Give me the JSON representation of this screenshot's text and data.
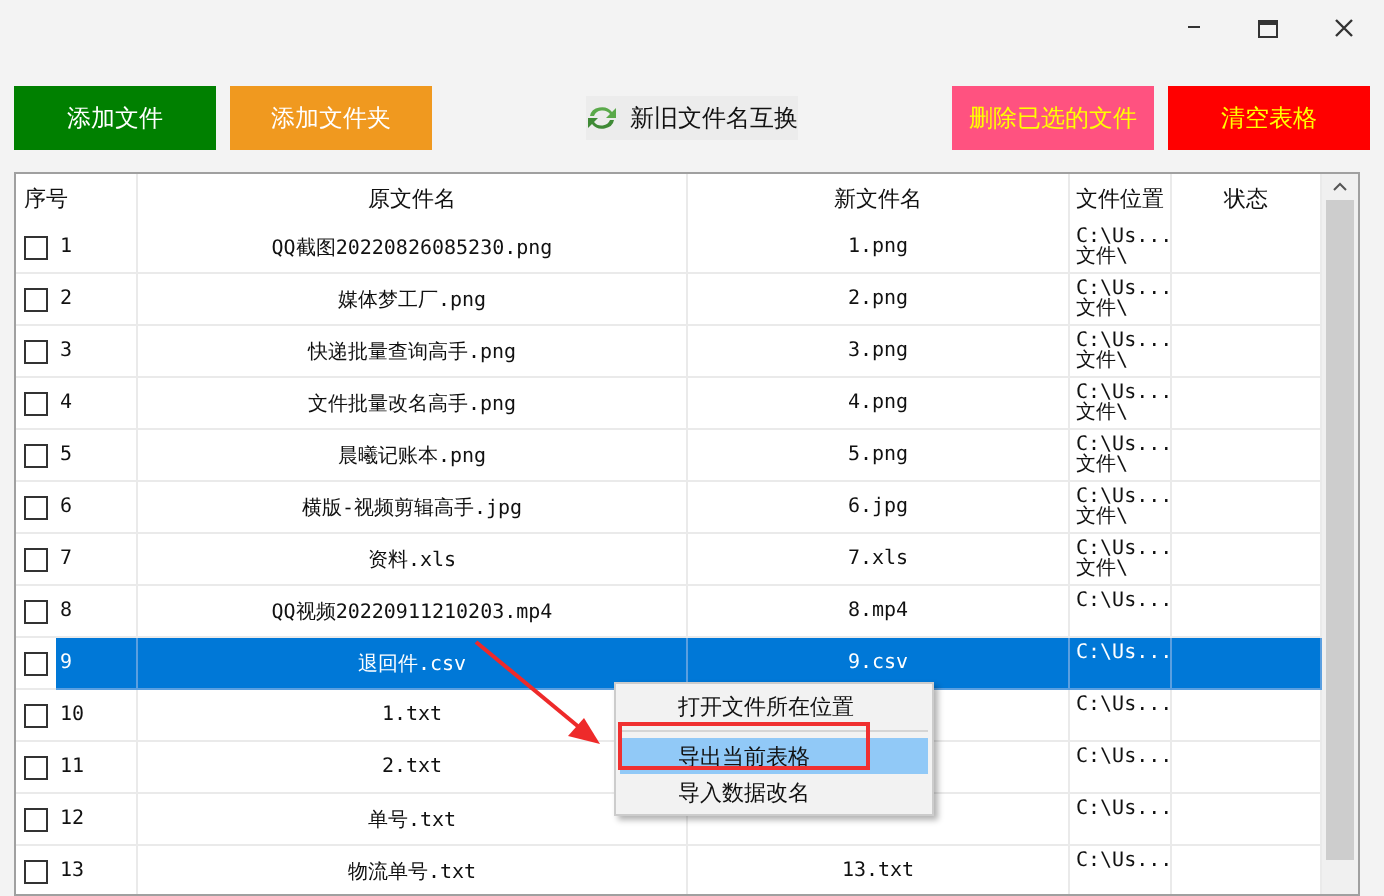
{
  "toolbar": {
    "buttons": [
      {
        "label": "添加文件",
        "kind": "add",
        "color": "#008000"
      },
      {
        "label": "添加文件夹",
        "kind": "add",
        "color": "#f0991f"
      },
      {
        "label": "新旧文件名互换",
        "kind": "plain"
      },
      {
        "label": "删除已选的文件",
        "kind": "remove",
        "color": "#ff5280"
      },
      {
        "label": "清空表格",
        "kind": "remove",
        "color": "#ff0000"
      }
    ]
  },
  "table": {
    "columns": [
      "序号",
      "原文件名",
      "新文件名",
      "文件位置",
      "状态"
    ],
    "rows": [
      {
        "checked": false,
        "selected": false,
        "index": "1",
        "original_name": "QQ截图20220826085230.png",
        "new_name": "1.png",
        "location": [
          "C:\\Us...",
          "文件\\"
        ]
      },
      {
        "checked": false,
        "selected": false,
        "index": "2",
        "original_name": "媒体梦工厂.png",
        "new_name": "2.png",
        "location": [
          "C:\\Us...",
          "文件\\"
        ]
      },
      {
        "checked": false,
        "selected": false,
        "index": "3",
        "original_name": "快递批量查询高手.png",
        "new_name": "3.png",
        "location": [
          "C:\\Us...",
          "文件\\"
        ]
      },
      {
        "checked": false,
        "selected": false,
        "index": "4",
        "original_name": "文件批量改名高手.png",
        "new_name": "4.png",
        "location": [
          "C:\\Us...",
          "文件\\"
        ]
      },
      {
        "checked": false,
        "selected": false,
        "index": "5",
        "original_name": "晨曦记账本.png",
        "new_name": "5.png",
        "location": [
          "C:\\Us...",
          "文件\\"
        ]
      },
      {
        "checked": false,
        "selected": false,
        "index": "6",
        "original_name": "横版-视频剪辑高手.jpg",
        "new_name": "6.jpg",
        "location": [
          "C:\\Us...",
          "文件\\"
        ]
      },
      {
        "checked": false,
        "selected": false,
        "index": "7",
        "original_name": "资料.xls",
        "new_name": "7.xls",
        "location": [
          "C:\\Us...",
          "文件\\"
        ]
      },
      {
        "checked": false,
        "selected": false,
        "index": "8",
        "original_name": "QQ视频20220911210203.mp4",
        "new_name": "8.mp4",
        "location": [
          "C:\\Us..."
        ]
      },
      {
        "checked": false,
        "selected": true,
        "index": "9",
        "original_name": "退回件.csv",
        "new_name": "9.csv",
        "location": [
          "C:\\Us..."
        ]
      },
      {
        "checked": false,
        "selected": false,
        "index": "10",
        "original_name": "1.txt",
        "location": [
          "C:\\Us..."
        ]
      },
      {
        "checked": false,
        "selected": false,
        "index": "11",
        "original_name": "2.txt",
        "location": [
          "C:\\Us..."
        ]
      },
      {
        "checked": false,
        "selected": false,
        "index": "12",
        "original_name": "单号.txt",
        "location": [
          "C:\\Us..."
        ]
      },
      {
        "checked": false,
        "selected": false,
        "index": "13",
        "original_name": "物流单号.txt",
        "new_name": "13.txt",
        "location": [
          "C:\\Us..."
        ]
      }
    ]
  },
  "context_menu": {
    "items": [
      {
        "kind": "item",
        "label": "打开文件所在位置",
        "highlighted": false
      },
      {
        "kind": "separator"
      },
      {
        "kind": "item",
        "label": "导出当前表格",
        "highlighted": true
      },
      {
        "kind": "item",
        "label": "导入数据改名",
        "highlighted": false
      }
    ]
  }
}
